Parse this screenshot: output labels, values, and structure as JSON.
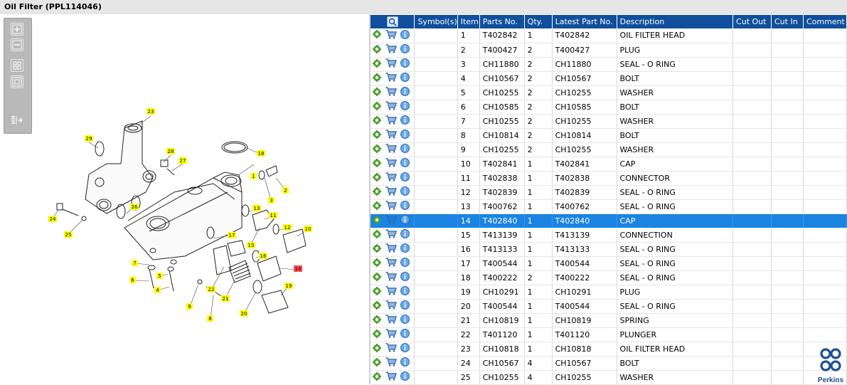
{
  "window": {
    "title": "Oil Filter (PPL114046)"
  },
  "toolbar": {
    "buttons": [
      "zoom-in",
      "zoom-out",
      "fit-all",
      "fit-window",
      "export-list"
    ]
  },
  "drawing": {
    "highlighted_callout": "14",
    "callouts": [
      "1",
      "2",
      "3",
      "4",
      "5",
      "6",
      "7",
      "8",
      "9",
      "10",
      "11",
      "12",
      "13",
      "14",
      "15",
      "16",
      "17",
      "18",
      "19",
      "20",
      "21",
      "22",
      "23",
      "24",
      "25",
      "26",
      "27",
      "28",
      "29"
    ]
  },
  "table": {
    "headers": {
      "symbols": "Symbol(s)",
      "item": "Item",
      "parts_no": "Parts No.",
      "qty": "Qty.",
      "latest": "Latest Part No.",
      "description": "Description",
      "cut_out": "Cut Out",
      "cut_in": "Cut In",
      "comment": "Comment"
    },
    "selected_item": "14",
    "rows": [
      {
        "item": "1",
        "parts_no": "T402842",
        "qty": "1",
        "latest": "T402842",
        "description": "OIL FILTER HEAD"
      },
      {
        "item": "2",
        "parts_no": "T400427",
        "qty": "2",
        "latest": "T400427",
        "description": "PLUG"
      },
      {
        "item": "3",
        "parts_no": "CH11880",
        "qty": "2",
        "latest": "CH11880",
        "description": "SEAL - O RING"
      },
      {
        "item": "4",
        "parts_no": "CH10567",
        "qty": "2",
        "latest": "CH10567",
        "description": "BOLT"
      },
      {
        "item": "5",
        "parts_no": "CH10255",
        "qty": "2",
        "latest": "CH10255",
        "description": "WASHER"
      },
      {
        "item": "6",
        "parts_no": "CH10585",
        "qty": "2",
        "latest": "CH10585",
        "description": "BOLT"
      },
      {
        "item": "7",
        "parts_no": "CH10255",
        "qty": "2",
        "latest": "CH10255",
        "description": "WASHER"
      },
      {
        "item": "8",
        "parts_no": "CH10814",
        "qty": "2",
        "latest": "CH10814",
        "description": "BOLT"
      },
      {
        "item": "9",
        "parts_no": "CH10255",
        "qty": "2",
        "latest": "CH10255",
        "description": "WASHER"
      },
      {
        "item": "10",
        "parts_no": "T402841",
        "qty": "1",
        "latest": "T402841",
        "description": "CAP"
      },
      {
        "item": "11",
        "parts_no": "T402838",
        "qty": "1",
        "latest": "T402838",
        "description": "CONNECTOR"
      },
      {
        "item": "12",
        "parts_no": "T402839",
        "qty": "1",
        "latest": "T402839",
        "description": "SEAL - O RING"
      },
      {
        "item": "13",
        "parts_no": "T400762",
        "qty": "1",
        "latest": "T400762",
        "description": "SEAL - O RING"
      },
      {
        "item": "14",
        "parts_no": "T402840",
        "qty": "1",
        "latest": "T402840",
        "description": "CAP"
      },
      {
        "item": "15",
        "parts_no": "T413139",
        "qty": "1",
        "latest": "T413139",
        "description": "CONNECTION"
      },
      {
        "item": "16",
        "parts_no": "T413133",
        "qty": "1",
        "latest": "T413133",
        "description": "SEAL - O RING"
      },
      {
        "item": "17",
        "parts_no": "T400544",
        "qty": "1",
        "latest": "T400544",
        "description": "SEAL - O RING"
      },
      {
        "item": "18",
        "parts_no": "T400222",
        "qty": "2",
        "latest": "T400222",
        "description": "SEAL - O RING"
      },
      {
        "item": "19",
        "parts_no": "CH10291",
        "qty": "1",
        "latest": "CH10291",
        "description": "PLUG"
      },
      {
        "item": "20",
        "parts_no": "T400544",
        "qty": "1",
        "latest": "T400544",
        "description": "SEAL - O RING"
      },
      {
        "item": "21",
        "parts_no": "CH10819",
        "qty": "1",
        "latest": "CH10819",
        "description": "SPRING"
      },
      {
        "item": "22",
        "parts_no": "T401120",
        "qty": "1",
        "latest": "T401120",
        "description": "PLUNGER"
      },
      {
        "item": "23",
        "parts_no": "CH10818",
        "qty": "1",
        "latest": "CH10818",
        "description": "OIL FILTER HEAD"
      },
      {
        "item": "24",
        "parts_no": "CH10567",
        "qty": "4",
        "latest": "CH10567",
        "description": "BOLT"
      },
      {
        "item": "25",
        "parts_no": "CH10255",
        "qty": "4",
        "latest": "CH10255",
        "description": "WASHER"
      }
    ]
  },
  "logo": {
    "text": "Perkins"
  },
  "colors": {
    "header_bg": "#0f4f9b",
    "selected_row": "#1a84e3",
    "callout_bg": "#ffff00",
    "callout_highlight": "#ff4d4d"
  },
  "icons": [
    "gear-icon",
    "cart-icon",
    "info-icon",
    "search-icon",
    "zoom-in-icon",
    "zoom-out-icon",
    "fit-all-icon",
    "fit-window-icon",
    "export-list-icon"
  ]
}
